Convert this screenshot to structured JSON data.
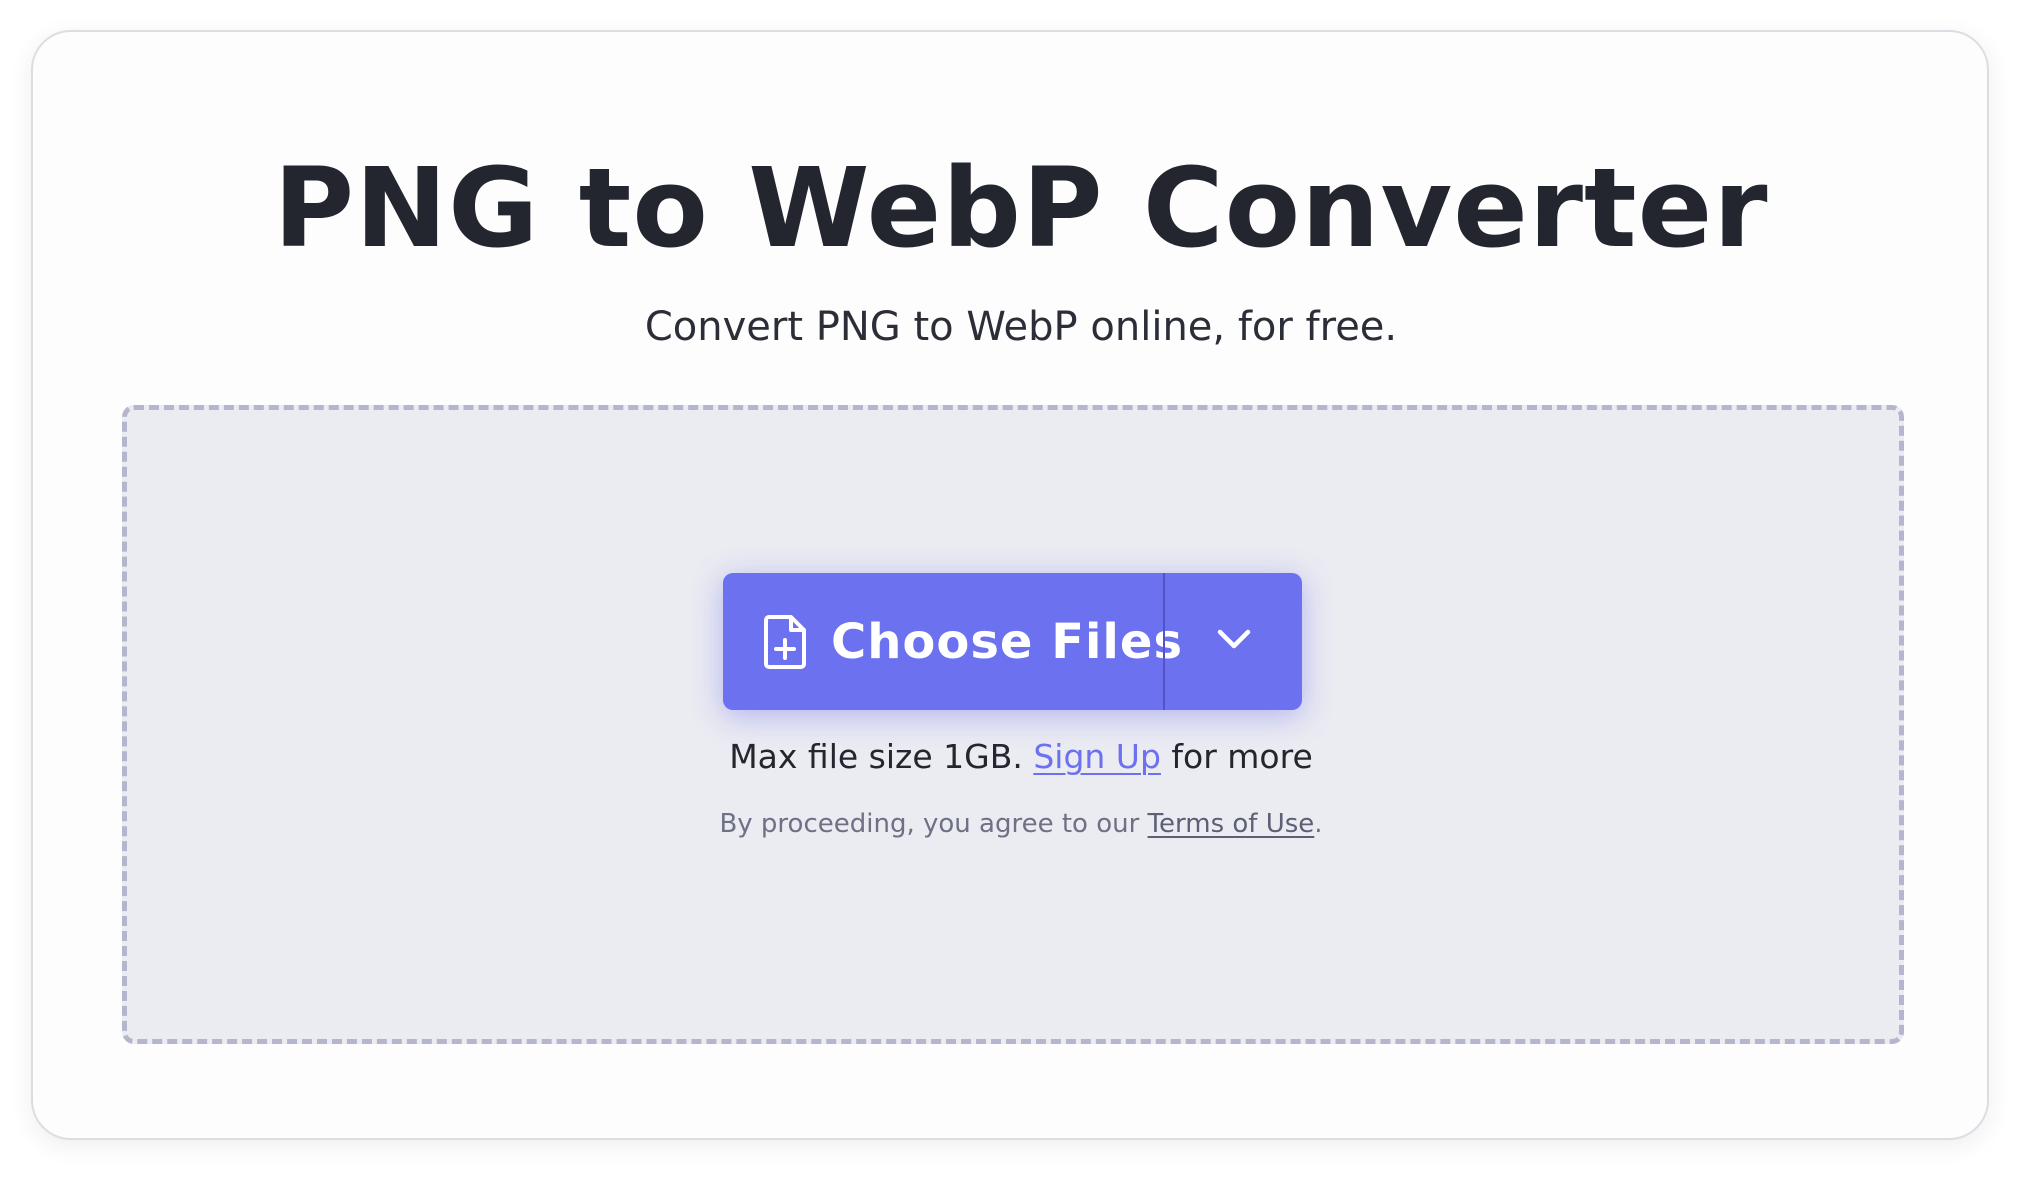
{
  "header": {
    "title": "PNG to WebP Converter",
    "subtitle": "Convert PNG to WebP online, for free."
  },
  "upload": {
    "choose_files_label": "Choose Files",
    "file_icon": "file-plus-icon",
    "dropdown_icon": "chevron-down-icon",
    "max_size_text": "Max file size 1GB.",
    "signup_link": "Sign Up",
    "max_size_suffix": "for more",
    "terms_prefix": "By proceeding, you agree to our",
    "terms_link": "Terms of Use",
    "terms_suffix": "."
  },
  "colors": {
    "accent": "#6b71ef",
    "title_text": "#23262f",
    "dropzone_bg": "#ebebf2",
    "dropzone_border": "#b5b5ce"
  }
}
